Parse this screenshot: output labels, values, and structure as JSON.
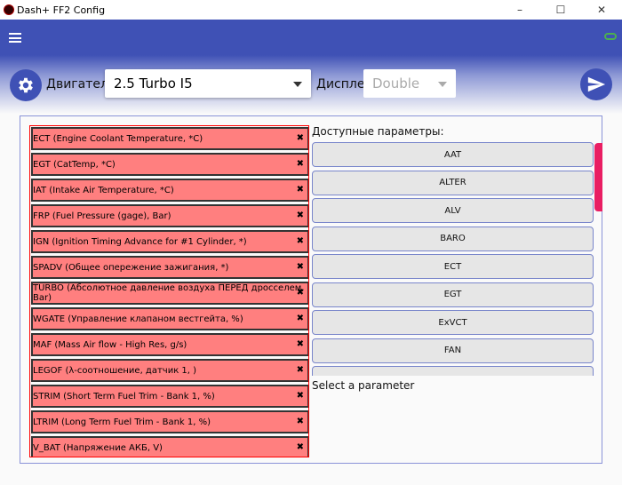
{
  "window": {
    "title": "Dash+ FF2 Config",
    "minimize": "–",
    "maximize": "☐",
    "close": "✕"
  },
  "toolbar": {
    "engine_label": "Двигатель:",
    "engine_value": "2.5 Turbo I5",
    "display_label": "Дисплей",
    "display_value": "Double"
  },
  "selected_params": [
    "ECT (Engine Coolant Temperature, *C)",
    "EGT (CatTemp, *C)",
    "IAT (Intake Air Temperature, *C)",
    "FRP (Fuel Pressure (gage), Bar)",
    "IGN (Ignition Timing Advance for #1 Cylinder, *)",
    "SPADV (Общее опережение зажигания, *)",
    "TURBO (Абсолютное давление воздуха ПЕРЕД дросселем, Bar)",
    "WGATE (Управление клапаном вестгейта, %)",
    "MAF (Mass Air flow - High Res, g/s)",
    "LEGOF (λ-соотношение, датчик 1, )",
    "STRIM (Short Term Fuel Trim - Bank 1, %)",
    "LTRIM (Long Term Fuel Trim - Bank 1, %)",
    "V_BAT (Напряжение АКБ, V)"
  ],
  "remove_glyph": "✖",
  "available": {
    "label": "Доступные параметры:",
    "items": [
      "AAT",
      "ALTER",
      "ALV",
      "BARO",
      "ECT",
      "EGT",
      "ExVCT",
      "FAN",
      ""
    ]
  },
  "status": "Select a parameter",
  "colors": {
    "accent": "#3f51b5",
    "item": "#ff7f7f",
    "scroll": "#e91e63",
    "link": "#4caf50"
  }
}
